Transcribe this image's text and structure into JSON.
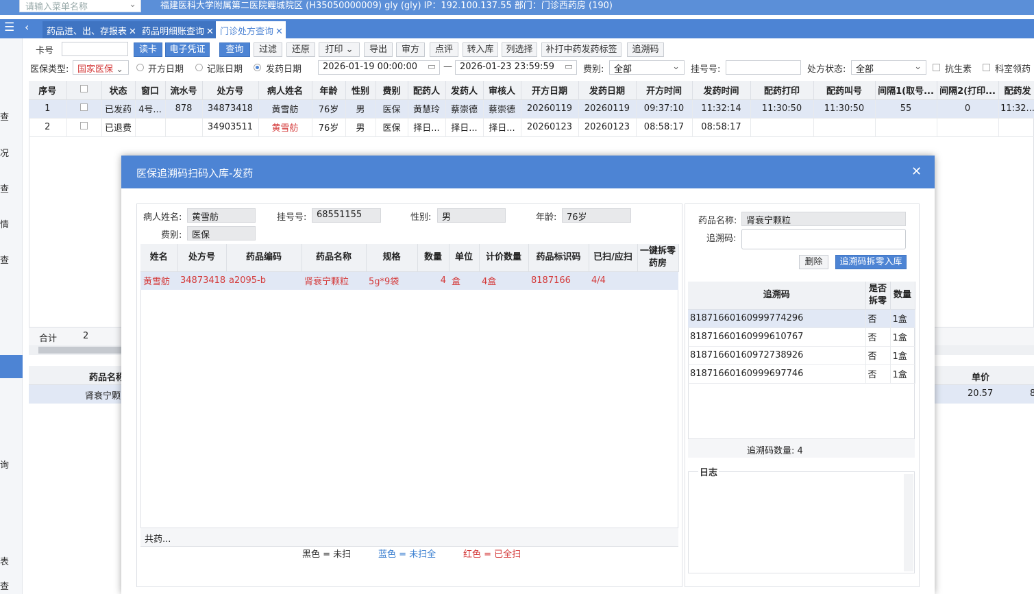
{
  "topbar": {
    "menu_search_placeholder": "请输入菜单名称",
    "hospital_info": "福建医科大学附属第二医院鲤城院区 (H35050000009) gly (gly) IP：192.100.137.55 部门：门诊西药房 (190)"
  },
  "tabs": [
    {
      "label": "药品进、出、存报表"
    },
    {
      "label": "药品明细账查询"
    },
    {
      "label": "门诊处方查询"
    }
  ],
  "sidebar": {
    "items": [
      "查",
      "况",
      "查",
      "情",
      "查",
      "询",
      "表",
      "查"
    ]
  },
  "toolbar": {
    "card_label": "卡号",
    "read_card": "读卡",
    "e_voucher": "电子凭证",
    "query": "查询",
    "filter": "过滤",
    "restore": "还原",
    "print": "打印",
    "export": "导出",
    "review": "审方",
    "comment": "点评",
    "transfer": "转入库",
    "column_select": "列选择",
    "reprint_label": "补打中药发药标签",
    "trace_code": "追溯码"
  },
  "filters": {
    "insurance_type_label": "医保类型:",
    "insurance_type_value": "国家医保",
    "radio_prescribe": "开方日期",
    "radio_account": "记账日期",
    "radio_dispense": "发药日期",
    "date_from": "2026-01-19 00:00:00",
    "date_sep": "—",
    "date_to": "2026-01-23 23:59:59",
    "fee_label": "费别:",
    "fee_value": "全部",
    "reg_label": "挂号号:",
    "status_label": "处方状态:",
    "status_value": "全部",
    "antibiotic": "抗生素",
    "dept_claim": "科室领药"
  },
  "main_grid": {
    "headers": [
      "序号",
      "",
      "状态",
      "窗口",
      "流水号",
      "处方号",
      "病人姓名",
      "年龄",
      "性别",
      "费别",
      "配药人",
      "发药人",
      "审核人",
      "开方日期",
      "发药日期",
      "开方时间",
      "发药时间",
      "配药打印",
      "配药叫号",
      "间隔1(取号...",
      "间隔2(打印...",
      "配药发"
    ],
    "rows": [
      [
        "1",
        "",
        "已发药",
        "4号...",
        "878",
        "34873418",
        "黄雪舫",
        "76岁",
        "男",
        "医保",
        "黄慧玲",
        "蔡崇德",
        "蔡崇德",
        "20260119",
        "20260119",
        "09:37:10",
        "11:32:14",
        "11:30:50",
        "11:30:50",
        "55",
        "0",
        "11:32..."
      ],
      [
        "2",
        "",
        "已退费",
        "",
        "",
        "34903511",
        "黄雪舫",
        "76岁",
        "男",
        "医保",
        "择日...",
        "择日...",
        "择日...",
        "20260123",
        "20260123",
        "08:58:17",
        "08:58:17",
        "",
        "",
        "",
        "",
        ""
      ]
    ],
    "total_label": "合计",
    "total_value": "2"
  },
  "detail_grid": {
    "drug_name_header": "药品名称",
    "unit_price_header": "单价",
    "drug_name": "肾衰宁颗",
    "unit_price": "20.57",
    "trailing": "8"
  },
  "modal": {
    "title": "医保追溯码扫码入库-发药",
    "patient": {
      "name_label": "病人姓名:",
      "name": "黄雪舫",
      "reg_label": "挂号号:",
      "reg": "68551155",
      "sex_label": "性别:",
      "sex": "男",
      "age_label": "年龄:",
      "age": "76岁",
      "fee_label": "费别:",
      "fee": "医保"
    },
    "drug_grid": {
      "headers": [
        "姓名",
        "处方号",
        "药品编码",
        "药品名称",
        "规格",
        "数量",
        "单位",
        "计价数量",
        "药品标识码",
        "已扫/应扫",
        "一键拆零药房"
      ],
      "rows": [
        [
          "黄雪舫",
          "34873418",
          "a2095-b",
          "肾衰宁颗粒",
          "5g*9袋",
          "4",
          "盒",
          "4盒",
          "8187166",
          "4/4",
          ""
        ]
      ],
      "footer": "共药..."
    },
    "legend": {
      "black": "黑色 = 未扫",
      "blue": "蓝色 = 未扫全",
      "red": "红色 = 已全扫",
      "blue_color": "#3b7fd0",
      "red_color": "#d43a3a"
    },
    "right": {
      "drug_name_label": "药品名称:",
      "drug_name": "肾衰宁颗粒",
      "trace_label": "追溯码:",
      "trace_value": "",
      "delete_btn": "删除",
      "split_btn": "追溯码拆零入库",
      "trace_headers": [
        "追溯码",
        "是否拆零",
        "数量"
      ],
      "trace_rows": [
        [
          "81871660160999774296",
          "否",
          "1盒"
        ],
        [
          "81871660160999610767",
          "否",
          "1盒"
        ],
        [
          "81871660160972738926",
          "否",
          "1盒"
        ],
        [
          "81871660160999697746",
          "否",
          "1盒"
        ]
      ],
      "trace_count": "追溯码数量: 4",
      "log_label": "日志"
    }
  }
}
